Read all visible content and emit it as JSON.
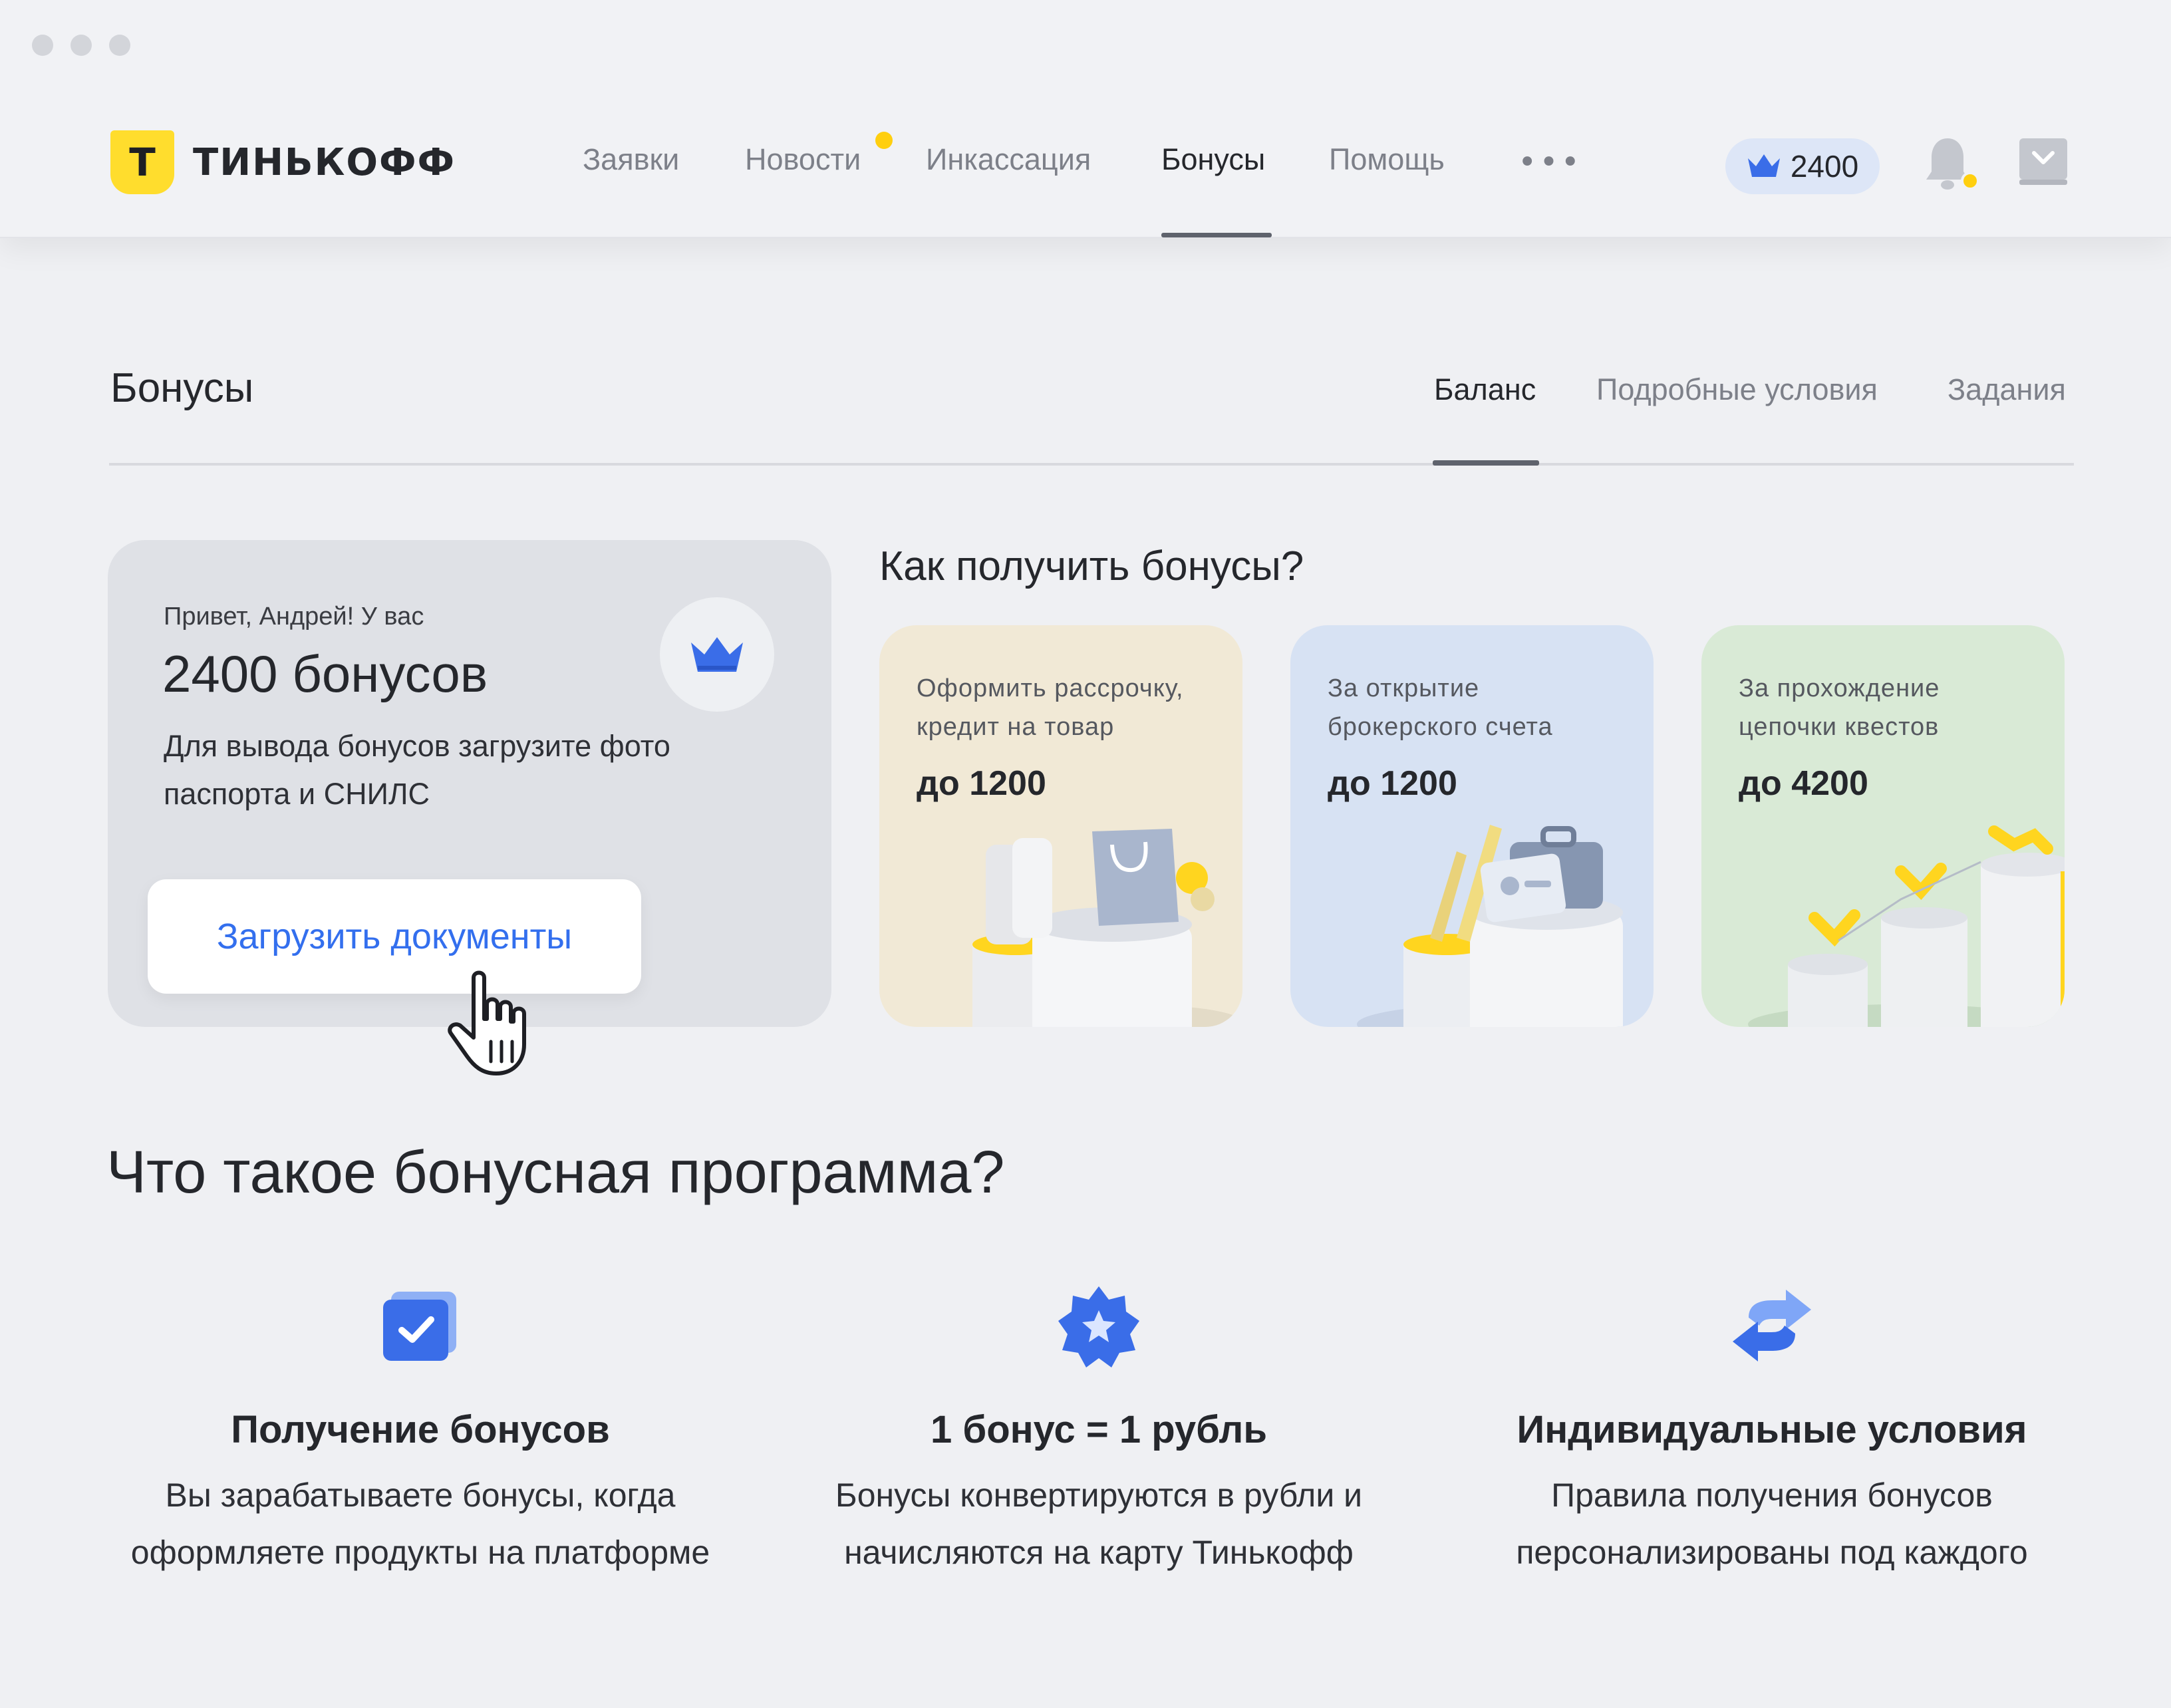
{
  "brand": {
    "name": "ТИНЬКОФФ",
    "logo_letter": "Т",
    "accent": "#ffdd2d",
    "link_color": "#336fee"
  },
  "nav": {
    "items": [
      {
        "label": "Заявки"
      },
      {
        "label": "Новости"
      },
      {
        "label": "Инкассация"
      },
      {
        "label": "Бонусы"
      },
      {
        "label": "Помощь"
      }
    ],
    "active": "Бонусы",
    "more_label": "•••"
  },
  "header": {
    "bonus_balance": "2400",
    "icons": [
      "crown-icon",
      "bell-icon",
      "inbox-icon"
    ]
  },
  "page": {
    "title": "Бонусы",
    "tabs": [
      {
        "label": "Баланс"
      },
      {
        "label": "Подробные условия"
      },
      {
        "label": "Задания"
      }
    ],
    "active_tab": "Баланс"
  },
  "balance_card": {
    "greeting": "Привет, Андрей! У вас",
    "amount": "2400 бонусов",
    "hint": "Для вывода бонусов загрузите фото паспорта и СНИЛС",
    "button_label": "Загрузить документы"
  },
  "howto": {
    "title": "Как получить бонусы?",
    "cards": [
      {
        "text": "Оформить рассрочку, кредит на товар",
        "amount": "до 1200",
        "bg": "#f1e9d6"
      },
      {
        "text": "За открытие брокерского счета",
        "amount": "до 1200",
        "bg": "#d7e2f3"
      },
      {
        "text": "За  прохождение цепочки квестов",
        "amount": "до 4200",
        "bg": "#d9ead6"
      }
    ]
  },
  "program": {
    "title": "Что такое бонусная программа?",
    "features": [
      {
        "icon": "checklist-icon",
        "title": "Получение бонусов",
        "desc": "Вы зарабатываете бонусы, когда оформляете продукты на платформе"
      },
      {
        "icon": "star-badge-icon",
        "title": "1 бонус = 1 рубль",
        "desc": "Бонусы конвертируются в рубли и начисляются на карту Тинькофф"
      },
      {
        "icon": "exchange-arrows-icon",
        "title": "Индивидуальные условия",
        "desc": "Правила получения бонусов персонализированы под каждого"
      }
    ]
  }
}
